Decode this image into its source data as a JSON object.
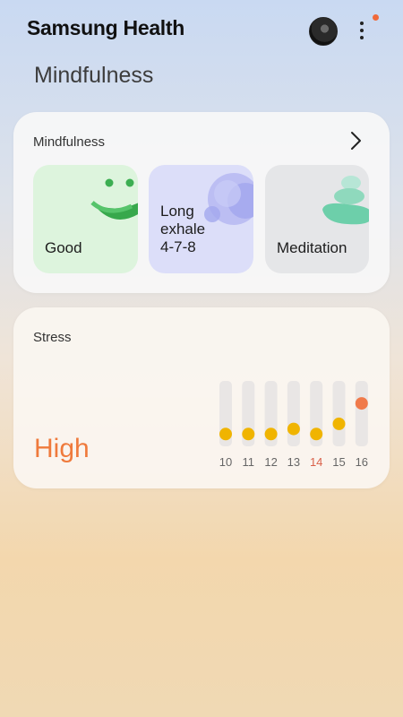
{
  "app": {
    "title": "Samsung Health"
  },
  "icons": {
    "avatar": "user-avatar",
    "menu": "more-vert-icon",
    "chevron": "chevron-right-icon"
  },
  "page": {
    "title": "Mindfulness"
  },
  "mindfulness": {
    "title": "Mindfulness",
    "tiles": [
      {
        "label": "Good",
        "icon": "smiley-mood-icon",
        "color": "#ddf4dd"
      },
      {
        "label": "Long exhale 4-7-8",
        "line1": "Long",
        "line2": "exhale",
        "line3": "4-7-8",
        "icon": "breathing-bubbles-icon",
        "color": "#dcdef9"
      },
      {
        "label": "Meditation",
        "icon": "stacked-stones-icon",
        "color": "#e5e6e8"
      }
    ]
  },
  "stress": {
    "title": "Stress",
    "level": "High",
    "level_color": "#ef7a3c",
    "chart_data": {
      "type": "scatter",
      "x": [
        "10",
        "11",
        "12",
        "13",
        "14",
        "15",
        "16"
      ],
      "y": [
        1,
        1,
        1,
        2,
        1,
        3,
        7
      ],
      "ylim": [
        0,
        10
      ],
      "highlight_x": "14",
      "highlight_color": "#d9614a",
      "point_color": "#f0b400",
      "latest_color": "#f07a4a"
    }
  }
}
